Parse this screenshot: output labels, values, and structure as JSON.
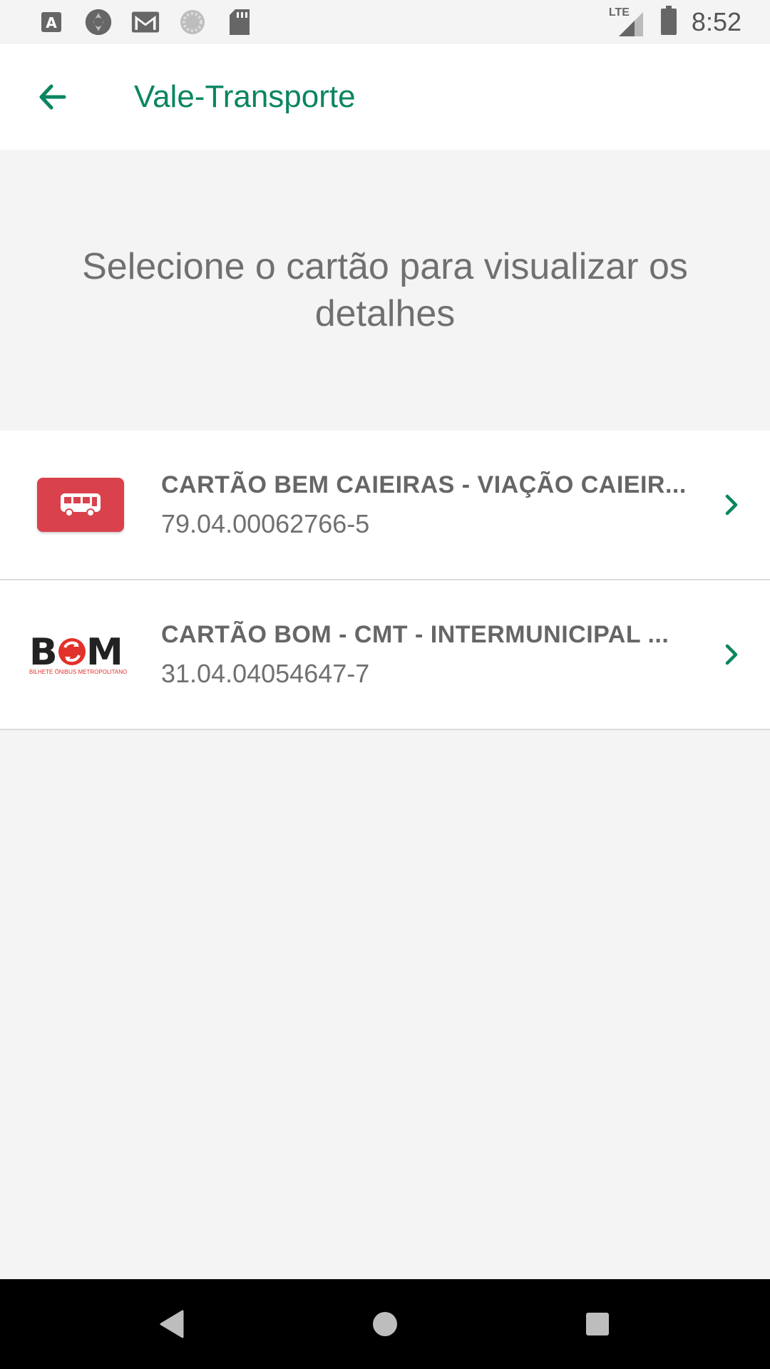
{
  "status_bar": {
    "time": "8:52",
    "network": "LTE",
    "icons": [
      "font-app-icon",
      "camera-aperture-icon",
      "gmail-icon",
      "loading-icon",
      "sd-card-icon",
      "signal-icon",
      "battery-icon"
    ]
  },
  "app_bar": {
    "back_icon": "arrow-left-icon",
    "title": "Vale-Transporte"
  },
  "header": {
    "message": "Selecione o cartão para visualizar os detalhes"
  },
  "cards": [
    {
      "logo": "bus-icon",
      "title": "CARTÃO BEM CAIEIRAS - VIAÇÃO CAIEIR...",
      "number": "79.04.00062766-5"
    },
    {
      "logo": "bom-logo",
      "logo_text": "BOM",
      "logo_subtext": "BILHETE ÔNIBUS METROPOLITANO",
      "title": "CARTÃO BOM - CMT - INTERMUNICIPAL ...",
      "number": "31.04.04054647-7"
    }
  ],
  "nav_bar": {
    "buttons": [
      "back-triangle-icon",
      "home-circle-icon",
      "recents-square-icon"
    ]
  },
  "colors": {
    "accent": "#0a8560",
    "bus_badge": "#d9424c",
    "background": "#f4f4f4"
  }
}
